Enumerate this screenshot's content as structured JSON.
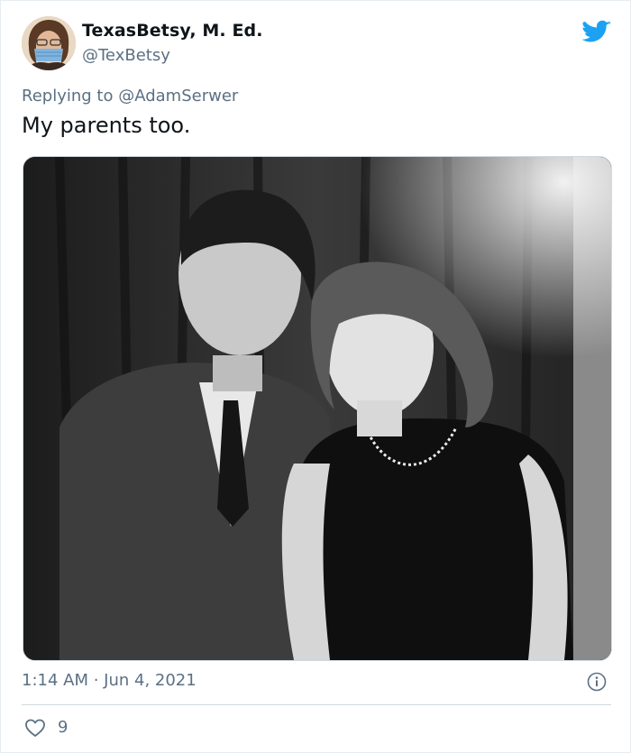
{
  "tweet": {
    "author_name": "TexasBetsy, M. Ed.",
    "author_handle": "@TexBetsy",
    "reply_prefix": "Replying to ",
    "reply_to": "@AdamSerwer",
    "text": "My parents too.",
    "timestamp": "1:14 AM · Jun 4, 2021",
    "like_count": "9"
  },
  "icons": {
    "brand": "twitter-bird-icon",
    "info": "info-icon",
    "like": "heart-icon"
  },
  "colors": {
    "brand": "#1da1f2",
    "secondary_text": "#5b7083",
    "primary_text": "#0f1419"
  }
}
